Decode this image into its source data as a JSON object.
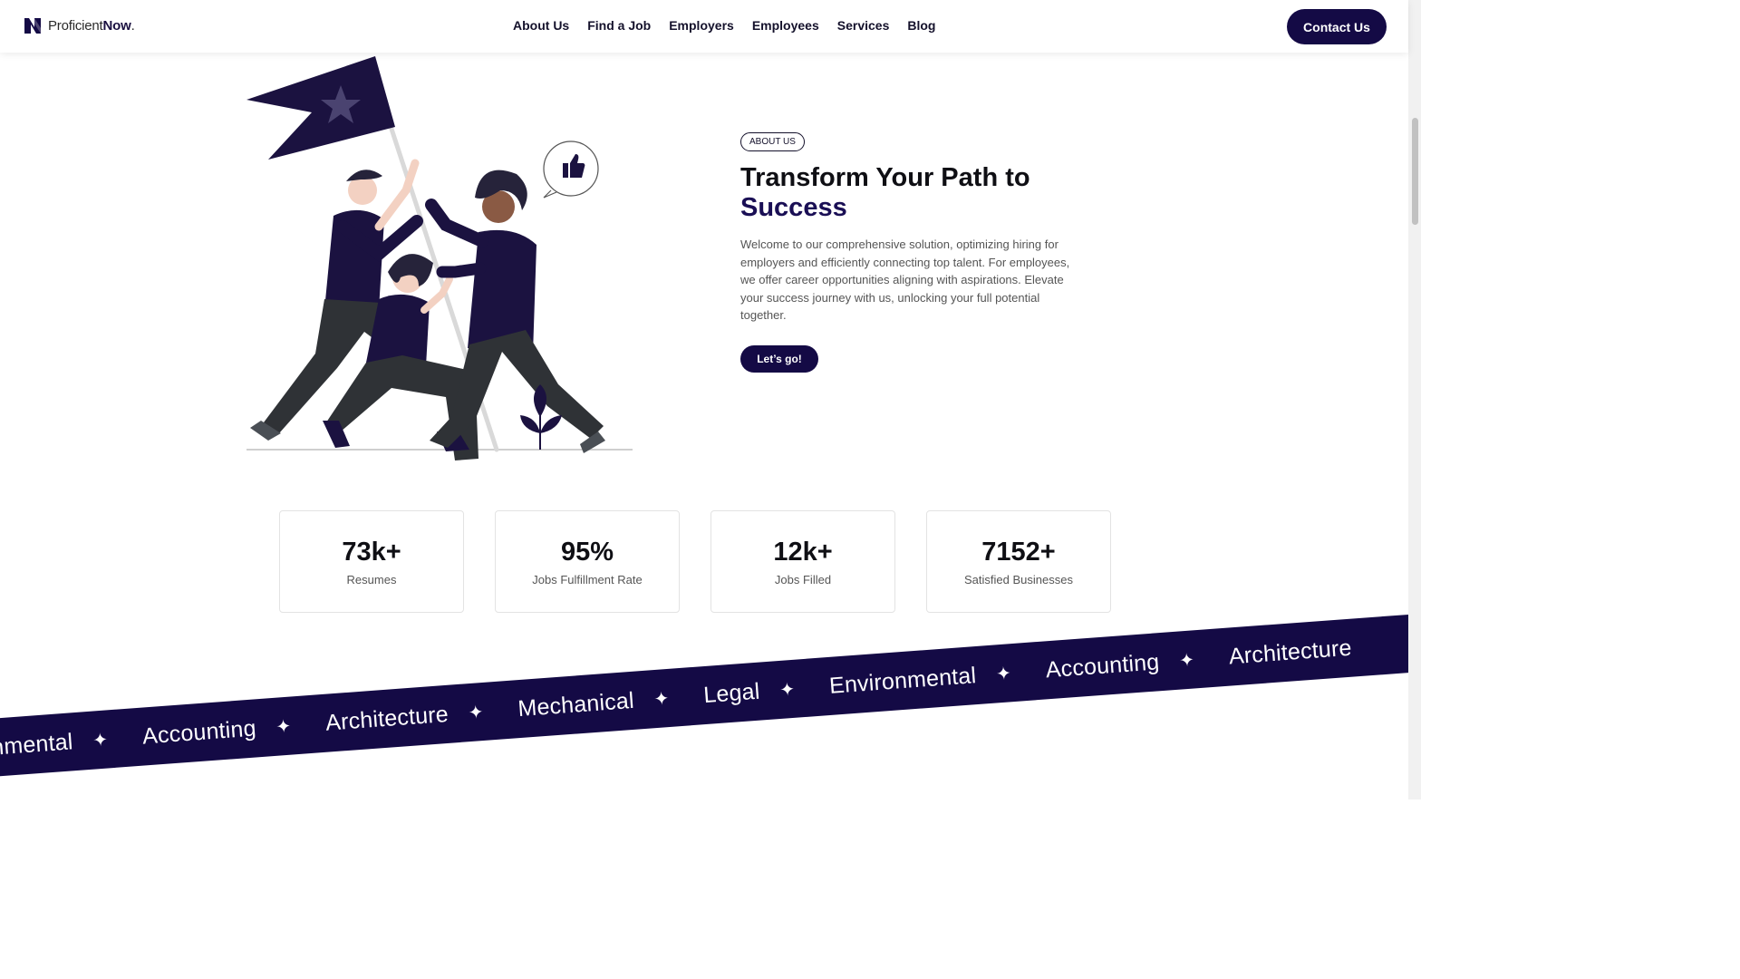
{
  "brand": {
    "name_light": "Proficient",
    "name_bold": "Now",
    "suffix": "."
  },
  "nav": {
    "items": [
      "About Us",
      "Find a Job",
      "Employers",
      "Employees",
      "Services",
      "Blog"
    ],
    "contact_label": "Contact Us"
  },
  "hero": {
    "badge": "ABOUT US",
    "title_line1": "Transform Your Path to",
    "title_line2": "Success",
    "description": "Welcome to our comprehensive solution, optimizing hiring for employers and efficiently connecting top talent. For employees, we offer career opportunities aligning with aspirations. Elevate your success journey with us, unlocking your full potential together.",
    "cta_label": "Let’s go!"
  },
  "stats": [
    {
      "value": "73k+",
      "label": "Resumes"
    },
    {
      "value": "95%",
      "label": "Jobs Fulfillment Rate"
    },
    {
      "value": "12k+",
      "label": "Jobs Filled"
    },
    {
      "value": "7152+",
      "label": "Satisfied Businesses"
    }
  ],
  "ribbon": {
    "items": [
      "Environmental",
      "Accounting",
      "Architecture",
      "Mechanical",
      "Legal",
      "Environmental",
      "Accounting",
      "Architecture"
    ],
    "separator": "✦"
  },
  "colors": {
    "brand_dark": "#140a45",
    "accent_title": "#1a0f55",
    "text_muted": "#555555"
  }
}
